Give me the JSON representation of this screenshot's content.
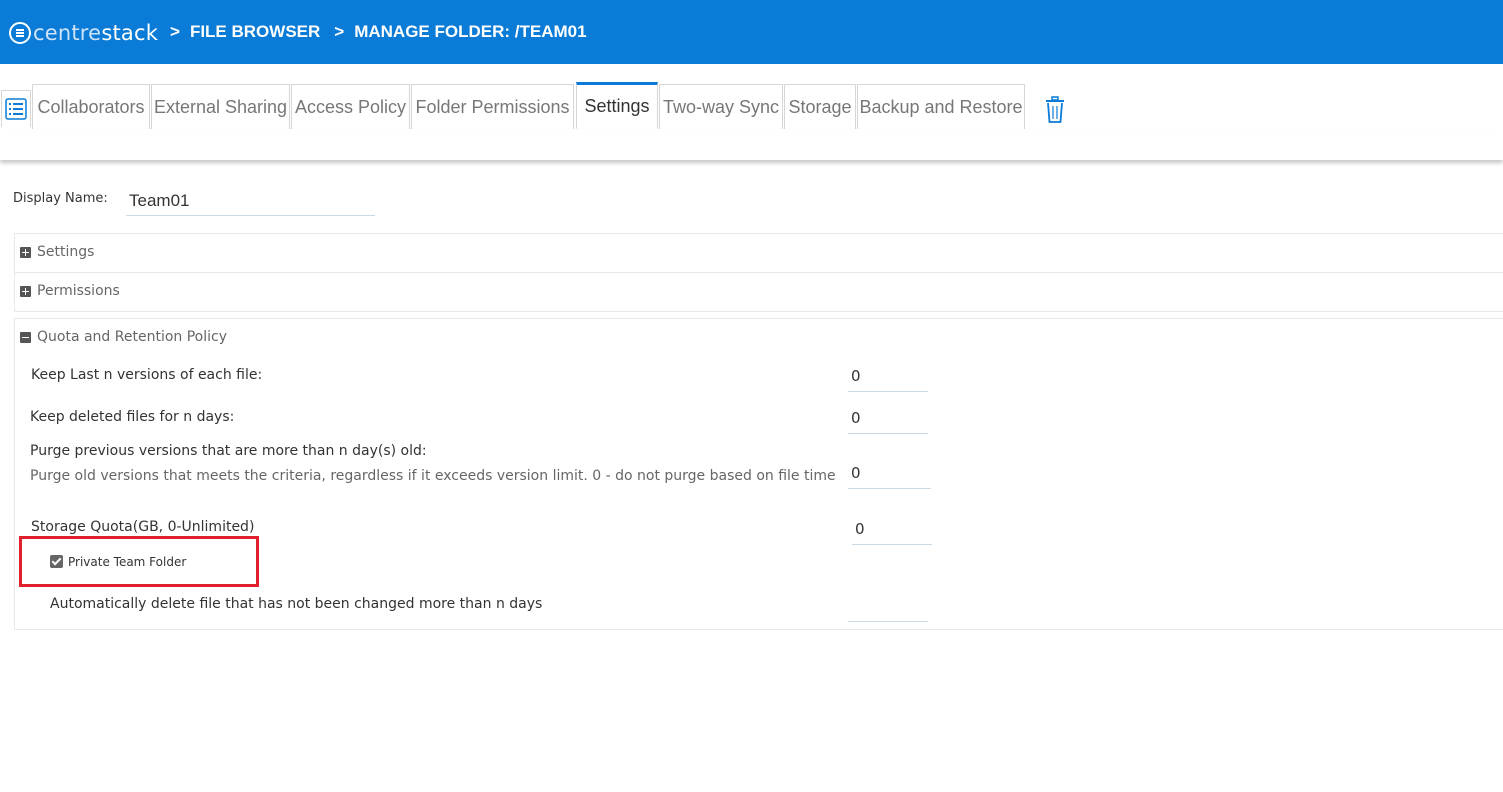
{
  "header": {
    "logo_text_a": "centre",
    "logo_text_b": "stack",
    "breadcrumb": [
      {
        "sep": ">",
        "label": "FILE BROWSER"
      },
      {
        "sep": ">",
        "label": "MANAGE FOLDER: /TEAM01"
      }
    ],
    "background_color": "#0a7bd6"
  },
  "tabs": [
    {
      "label": "Collaborators",
      "active": false
    },
    {
      "label": "External Sharing",
      "active": false
    },
    {
      "label": "Access Policy",
      "active": false
    },
    {
      "label": "Folder Permissions",
      "active": false
    },
    {
      "label": "Settings",
      "active": true
    },
    {
      "label": "Two-way Sync",
      "active": false
    },
    {
      "label": "Storage",
      "active": false
    },
    {
      "label": "Backup and Restore",
      "active": false
    }
  ],
  "display_name": {
    "label": "Display Name:",
    "value": "Team01"
  },
  "sections": {
    "settings": {
      "label": "Settings",
      "expanded": false
    },
    "permissions": {
      "label": "Permissions",
      "expanded": false
    },
    "quota": {
      "label": "Quota and Retention Policy",
      "expanded": true
    }
  },
  "quota": {
    "keep_versions": {
      "label": "Keep Last n versions of each file:",
      "value": "0"
    },
    "keep_deleted": {
      "label": "Keep deleted files for n days:",
      "value": "0"
    },
    "purge": {
      "label": "Purge previous versions that are more than n day(s) old:",
      "sublabel": "Purge old versions that meets the criteria, regardless if it exceeds version limit. 0 - do not purge based on file time",
      "value": "0"
    },
    "storage_quota": {
      "label": "Storage Quota(GB, 0-Unlimited)",
      "value": "0"
    },
    "private_team_folder": {
      "label": "Private Team Folder",
      "checked": true
    },
    "auto_delete": {
      "label": "Automatically delete file that has not been changed more than n days",
      "value": ""
    }
  },
  "colors": {
    "accent": "#0a7bd6",
    "highlight": "#e0202a"
  }
}
